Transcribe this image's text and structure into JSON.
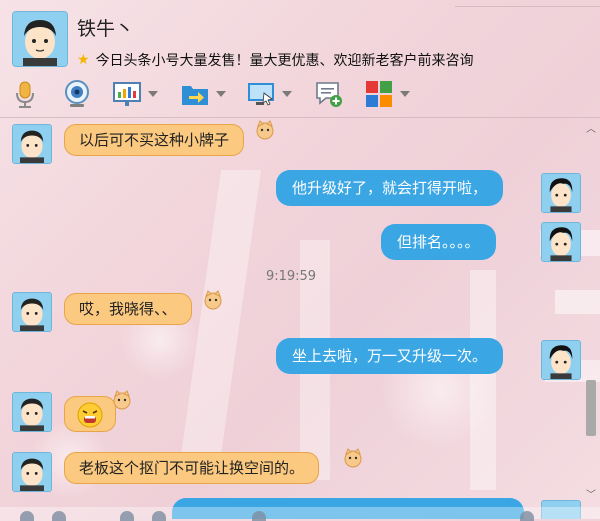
{
  "contact": {
    "name": "铁牛丶",
    "status_message": "今日头条小号大量发售！量大更优惠、欢迎新老客户前来咨询"
  },
  "toolbar": {
    "items": [
      {
        "name": "voice",
        "icon": "microphone-icon",
        "has_dropdown": false
      },
      {
        "name": "video",
        "icon": "webcam-icon",
        "has_dropdown": false
      },
      {
        "name": "screen-share",
        "icon": "presentation-icon",
        "has_dropdown": true
      },
      {
        "name": "file-transfer",
        "icon": "folder-send-icon",
        "has_dropdown": true
      },
      {
        "name": "remote-desktop",
        "icon": "monitor-icon",
        "has_dropdown": true
      },
      {
        "name": "add-chat",
        "icon": "message-add-icon",
        "has_dropdown": false
      },
      {
        "name": "apps",
        "icon": "app-grid-icon",
        "has_dropdown": true
      }
    ]
  },
  "messages": [
    {
      "side": "left",
      "text": "以后可不买这种小牌子"
    },
    {
      "side": "right",
      "text": "他升级好了，就会打得开啦，"
    },
    {
      "side": "right",
      "text": "但排名。。。。"
    },
    {
      "side": "time",
      "text": "9:19:59"
    },
    {
      "side": "left",
      "text": "哎，我晓得、、"
    },
    {
      "side": "right",
      "text": "坐上去啦，万一又升级一次。"
    },
    {
      "side": "left",
      "text": "😩",
      "is_emoji": true
    },
    {
      "side": "left",
      "text": "老板这个抠门不可能让换空间的。"
    }
  ],
  "colors": {
    "left_bubble": "#fbc97f",
    "left_bubble_border": "#e8a548",
    "right_bubble": "#3aa6e4",
    "avatar_bg": "#8fd0f0",
    "background": "#f2d6dc"
  }
}
